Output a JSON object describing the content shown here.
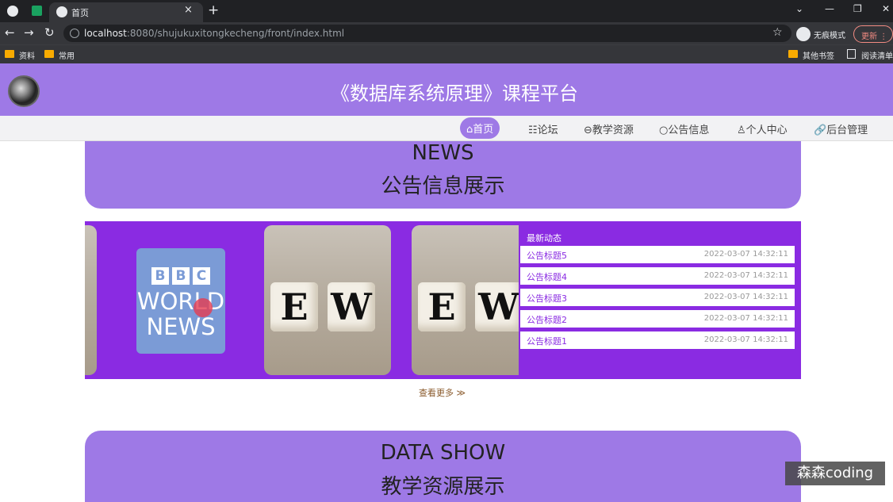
{
  "browser": {
    "tab_title": "首页",
    "url_host": "localhost",
    "url_rest": ":8080/shujukuxitongkecheng/front/index.html",
    "incognito_label": "无痕模式",
    "update_label": "更新",
    "bookmarks": [
      {
        "label": "资料",
        "icon": "folder-icon"
      },
      {
        "label": "常用",
        "icon": "folder-icon"
      }
    ],
    "bookmarks_right": [
      {
        "label": "其他书签",
        "icon": "folder-icon"
      },
      {
        "label": "阅读清单",
        "icon": "reading-list-icon"
      }
    ]
  },
  "site": {
    "title": "《数据库系统原理》课程平台",
    "nav": [
      {
        "label": "⌂首页",
        "active": true
      },
      {
        "label": "☷论坛"
      },
      {
        "label": "⊖教学资源"
      },
      {
        "label": "○公告信息"
      },
      {
        "label": "♙个人中心"
      },
      {
        "label": "🔗后台管理"
      }
    ]
  },
  "news_section": {
    "en_title": "NEWS",
    "cn_title": "公告信息展示",
    "latest_label": "最新动态",
    "items": [
      {
        "title": "公告标题5",
        "date": "2022-03-07 14:32:11"
      },
      {
        "title": "公告标题4",
        "date": "2022-03-07 14:32:11"
      },
      {
        "title": "公告标题3",
        "date": "2022-03-07 14:32:11"
      },
      {
        "title": "公告标题2",
        "date": "2022-03-07 14:32:11"
      },
      {
        "title": "公告标题1",
        "date": "2022-03-07 14:32:11"
      }
    ],
    "more_label": "查看更多 ≫",
    "carousel": {
      "bbc_letters": [
        "B",
        "B",
        "C"
      ],
      "bbc_world": "WORLD",
      "bbc_news": "NEWS",
      "dice_letters": [
        "E",
        "W"
      ]
    }
  },
  "data_section": {
    "en_title": "DATA SHOW",
    "cn_title": "教学资源展示"
  },
  "watermark": "森森coding",
  "colors": {
    "brand": "#9e79e6",
    "panel": "#8a2be2"
  }
}
